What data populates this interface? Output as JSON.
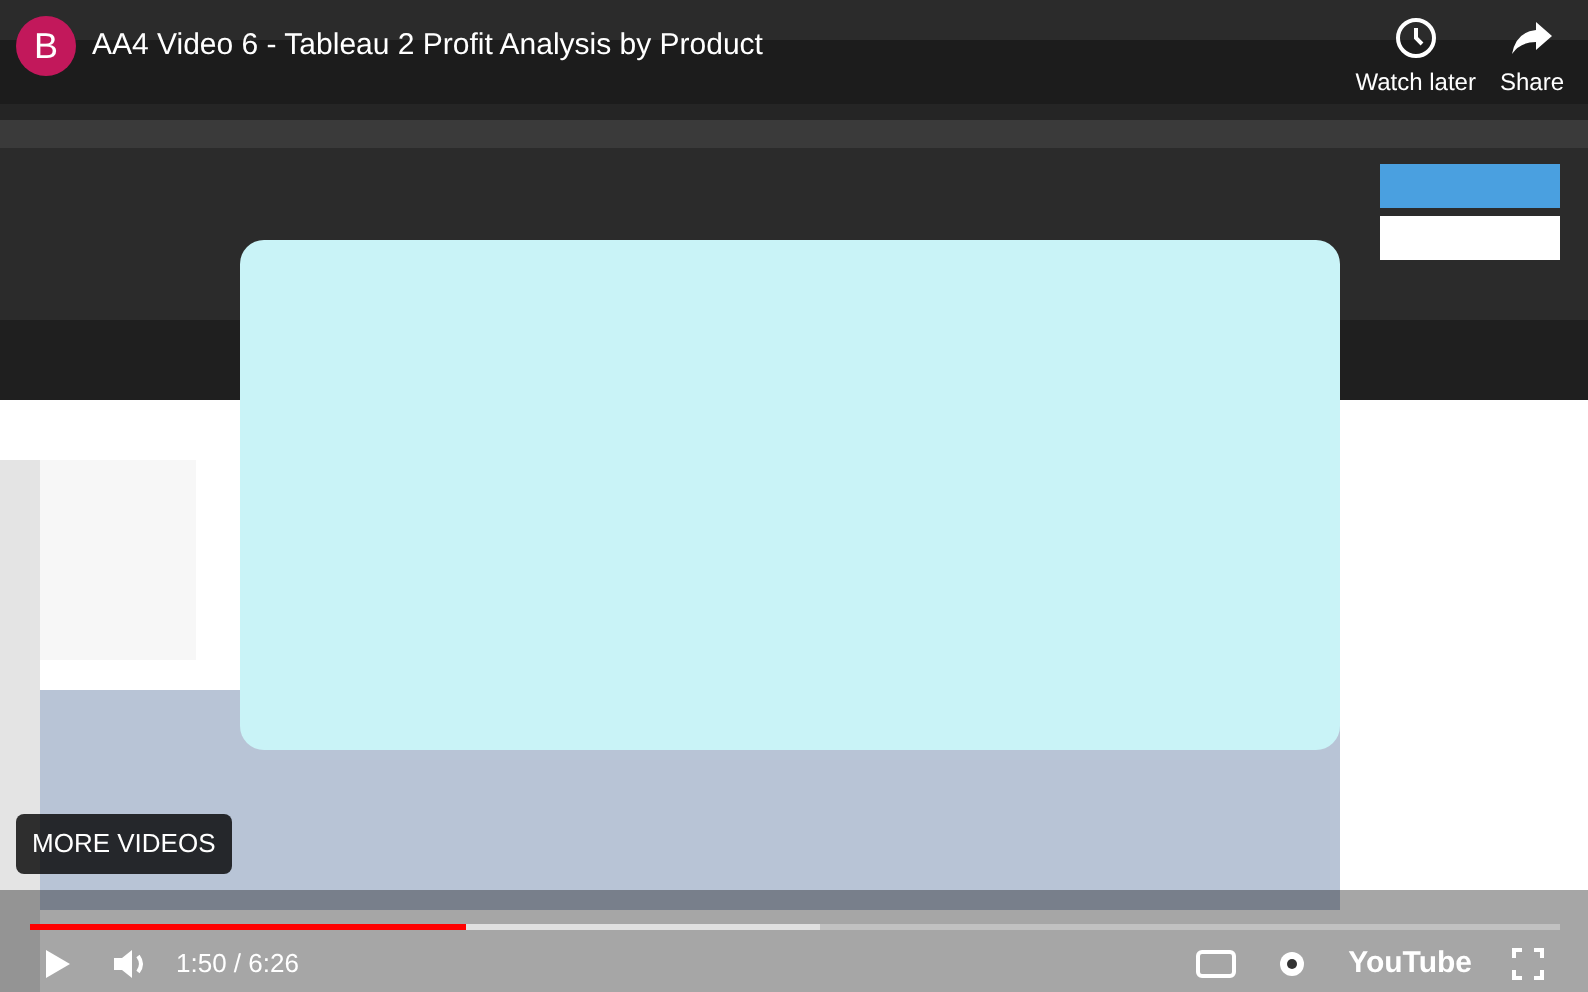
{
  "channel_avatar": {
    "letter": "B",
    "color": "#c2185b"
  },
  "title": "AA4 Video 6 - Tableau 2 Profit Analysis by Product",
  "top_actions": [
    {
      "kind": "clock",
      "label": "Watch later"
    },
    {
      "kind": "share",
      "label": "Share"
    }
  ],
  "more_videos": "MORE VIDEOS",
  "progress": {
    "level": 0.285
  },
  "controls": {
    "time": "1:50 / 6:26",
    "logo": "YouTube"
  }
}
